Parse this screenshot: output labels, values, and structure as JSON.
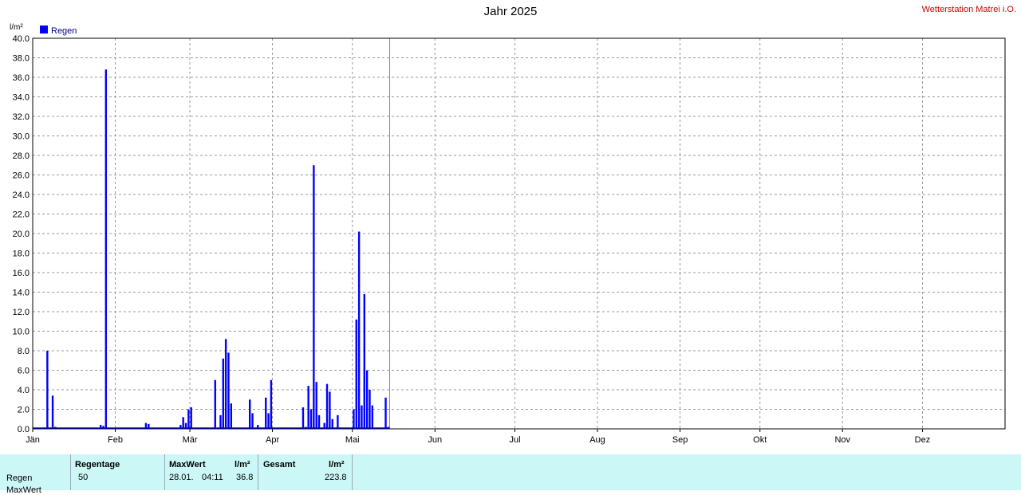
{
  "header": {
    "title": "Jahr 2025",
    "station": "Wetterstation Matrei i.O."
  },
  "chart_data": {
    "type": "bar",
    "title": "Jahr 2025",
    "ylabel": "l/m²",
    "ylim": [
      0,
      40
    ],
    "yticks": [
      "0.0",
      "2.0",
      "4.0",
      "6.0",
      "8.0",
      "10.0",
      "12.0",
      "14.0",
      "16.0",
      "18.0",
      "20.0",
      "22.0",
      "24.0",
      "26.0",
      "28.0",
      "30.0",
      "32.0",
      "34.0",
      "36.0",
      "38.0",
      "40.0"
    ],
    "xtick_labels": [
      "Jän",
      "Feb",
      "Mär",
      "Apr",
      "Mai",
      "Jun",
      "Jul",
      "Aug",
      "Sep",
      "Okt",
      "Nov",
      "Dez"
    ],
    "grid": true,
    "legend_position": "top-left",
    "color": "#0000ff",
    "series": [
      {
        "name": "Regen",
        "x": [
          "2025-01-06",
          "2025-01-08",
          "2025-01-09",
          "2025-01-26",
          "2025-01-27",
          "2025-01-28",
          "2025-02-12",
          "2025-02-13",
          "2025-02-25",
          "2025-02-26",
          "2025-02-27",
          "2025-02-28",
          "2025-03-01",
          "2025-03-10",
          "2025-03-12",
          "2025-03-13",
          "2025-03-14",
          "2025-03-15",
          "2025-03-16",
          "2025-03-23",
          "2025-03-24",
          "2025-03-26",
          "2025-03-29",
          "2025-03-30",
          "2025-03-31",
          "2025-04-12",
          "2025-04-13",
          "2025-04-14",
          "2025-04-15",
          "2025-04-16",
          "2025-04-17",
          "2025-04-18",
          "2025-04-20",
          "2025-04-21",
          "2025-04-22",
          "2025-04-23",
          "2025-04-25",
          "2025-05-01",
          "2025-05-02",
          "2025-05-03",
          "2025-05-04",
          "2025-05-05",
          "2025-05-06",
          "2025-05-07",
          "2025-05-08",
          "2025-05-13",
          "2025-05-14"
        ],
        "values": [
          8.0,
          3.4,
          0.2,
          0.4,
          0.3,
          36.8,
          0.6,
          0.5,
          0.4,
          1.2,
          0.6,
          2.0,
          2.2,
          5.0,
          1.4,
          7.2,
          9.2,
          7.8,
          2.6,
          3.0,
          1.6,
          0.4,
          3.2,
          1.6,
          5.0,
          2.2,
          0.2,
          4.4,
          2.0,
          27.0,
          4.8,
          1.4,
          0.6,
          4.6,
          3.8,
          1.0,
          1.4,
          2.0,
          11.2,
          20.2,
          2.4,
          13.8,
          6.0,
          4.0,
          2.4,
          3.2,
          0.2
        ]
      }
    ]
  },
  "stats": {
    "row_label": "Regen",
    "row_label2": "MaxWert",
    "regentage_header": "Regentage",
    "regentage_value": "50",
    "maxwert_header": "MaxWert",
    "maxwert_unit": "l/m²",
    "maxwert_date": "28.01.",
    "maxwert_time": "04:11",
    "maxwert_value": "36.8",
    "gesamt_header": "Gesamt",
    "gesamt_unit": "l/m²",
    "gesamt_value": "223.8"
  }
}
